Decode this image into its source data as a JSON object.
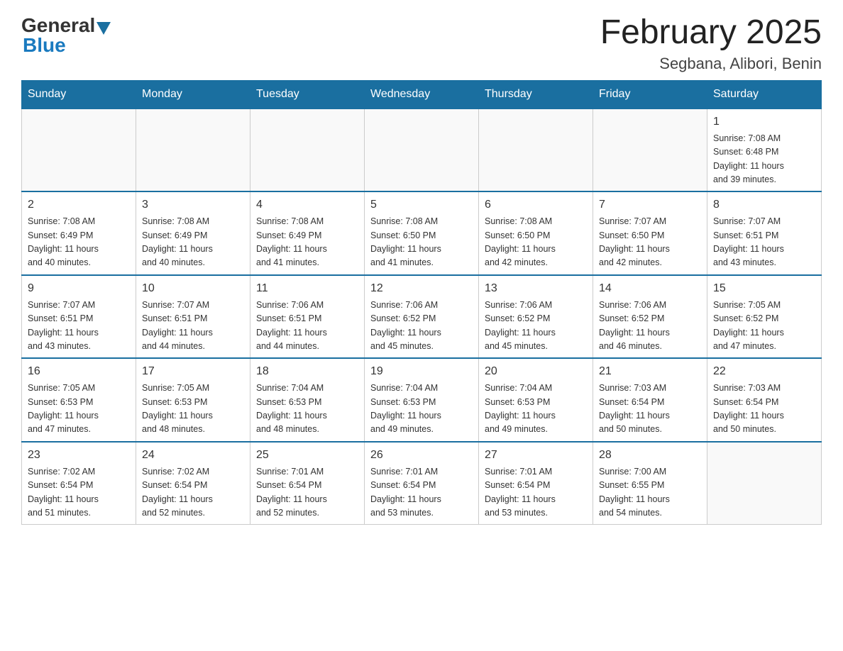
{
  "header": {
    "logo_general": "General",
    "logo_blue": "Blue",
    "title": "February 2025",
    "location": "Segbana, Alibori, Benin"
  },
  "days_of_week": [
    "Sunday",
    "Monday",
    "Tuesday",
    "Wednesday",
    "Thursday",
    "Friday",
    "Saturday"
  ],
  "weeks": [
    [
      {
        "day": "",
        "info": ""
      },
      {
        "day": "",
        "info": ""
      },
      {
        "day": "",
        "info": ""
      },
      {
        "day": "",
        "info": ""
      },
      {
        "day": "",
        "info": ""
      },
      {
        "day": "",
        "info": ""
      },
      {
        "day": "1",
        "info": "Sunrise: 7:08 AM\nSunset: 6:48 PM\nDaylight: 11 hours\nand 39 minutes."
      }
    ],
    [
      {
        "day": "2",
        "info": "Sunrise: 7:08 AM\nSunset: 6:49 PM\nDaylight: 11 hours\nand 40 minutes."
      },
      {
        "day": "3",
        "info": "Sunrise: 7:08 AM\nSunset: 6:49 PM\nDaylight: 11 hours\nand 40 minutes."
      },
      {
        "day": "4",
        "info": "Sunrise: 7:08 AM\nSunset: 6:49 PM\nDaylight: 11 hours\nand 41 minutes."
      },
      {
        "day": "5",
        "info": "Sunrise: 7:08 AM\nSunset: 6:50 PM\nDaylight: 11 hours\nand 41 minutes."
      },
      {
        "day": "6",
        "info": "Sunrise: 7:08 AM\nSunset: 6:50 PM\nDaylight: 11 hours\nand 42 minutes."
      },
      {
        "day": "7",
        "info": "Sunrise: 7:07 AM\nSunset: 6:50 PM\nDaylight: 11 hours\nand 42 minutes."
      },
      {
        "day": "8",
        "info": "Sunrise: 7:07 AM\nSunset: 6:51 PM\nDaylight: 11 hours\nand 43 minutes."
      }
    ],
    [
      {
        "day": "9",
        "info": "Sunrise: 7:07 AM\nSunset: 6:51 PM\nDaylight: 11 hours\nand 43 minutes."
      },
      {
        "day": "10",
        "info": "Sunrise: 7:07 AM\nSunset: 6:51 PM\nDaylight: 11 hours\nand 44 minutes."
      },
      {
        "day": "11",
        "info": "Sunrise: 7:06 AM\nSunset: 6:51 PM\nDaylight: 11 hours\nand 44 minutes."
      },
      {
        "day": "12",
        "info": "Sunrise: 7:06 AM\nSunset: 6:52 PM\nDaylight: 11 hours\nand 45 minutes."
      },
      {
        "day": "13",
        "info": "Sunrise: 7:06 AM\nSunset: 6:52 PM\nDaylight: 11 hours\nand 45 minutes."
      },
      {
        "day": "14",
        "info": "Sunrise: 7:06 AM\nSunset: 6:52 PM\nDaylight: 11 hours\nand 46 minutes."
      },
      {
        "day": "15",
        "info": "Sunrise: 7:05 AM\nSunset: 6:52 PM\nDaylight: 11 hours\nand 47 minutes."
      }
    ],
    [
      {
        "day": "16",
        "info": "Sunrise: 7:05 AM\nSunset: 6:53 PM\nDaylight: 11 hours\nand 47 minutes."
      },
      {
        "day": "17",
        "info": "Sunrise: 7:05 AM\nSunset: 6:53 PM\nDaylight: 11 hours\nand 48 minutes."
      },
      {
        "day": "18",
        "info": "Sunrise: 7:04 AM\nSunset: 6:53 PM\nDaylight: 11 hours\nand 48 minutes."
      },
      {
        "day": "19",
        "info": "Sunrise: 7:04 AM\nSunset: 6:53 PM\nDaylight: 11 hours\nand 49 minutes."
      },
      {
        "day": "20",
        "info": "Sunrise: 7:04 AM\nSunset: 6:53 PM\nDaylight: 11 hours\nand 49 minutes."
      },
      {
        "day": "21",
        "info": "Sunrise: 7:03 AM\nSunset: 6:54 PM\nDaylight: 11 hours\nand 50 minutes."
      },
      {
        "day": "22",
        "info": "Sunrise: 7:03 AM\nSunset: 6:54 PM\nDaylight: 11 hours\nand 50 minutes."
      }
    ],
    [
      {
        "day": "23",
        "info": "Sunrise: 7:02 AM\nSunset: 6:54 PM\nDaylight: 11 hours\nand 51 minutes."
      },
      {
        "day": "24",
        "info": "Sunrise: 7:02 AM\nSunset: 6:54 PM\nDaylight: 11 hours\nand 52 minutes."
      },
      {
        "day": "25",
        "info": "Sunrise: 7:01 AM\nSunset: 6:54 PM\nDaylight: 11 hours\nand 52 minutes."
      },
      {
        "day": "26",
        "info": "Sunrise: 7:01 AM\nSunset: 6:54 PM\nDaylight: 11 hours\nand 53 minutes."
      },
      {
        "day": "27",
        "info": "Sunrise: 7:01 AM\nSunset: 6:54 PM\nDaylight: 11 hours\nand 53 minutes."
      },
      {
        "day": "28",
        "info": "Sunrise: 7:00 AM\nSunset: 6:55 PM\nDaylight: 11 hours\nand 54 minutes."
      },
      {
        "day": "",
        "info": ""
      }
    ]
  ]
}
